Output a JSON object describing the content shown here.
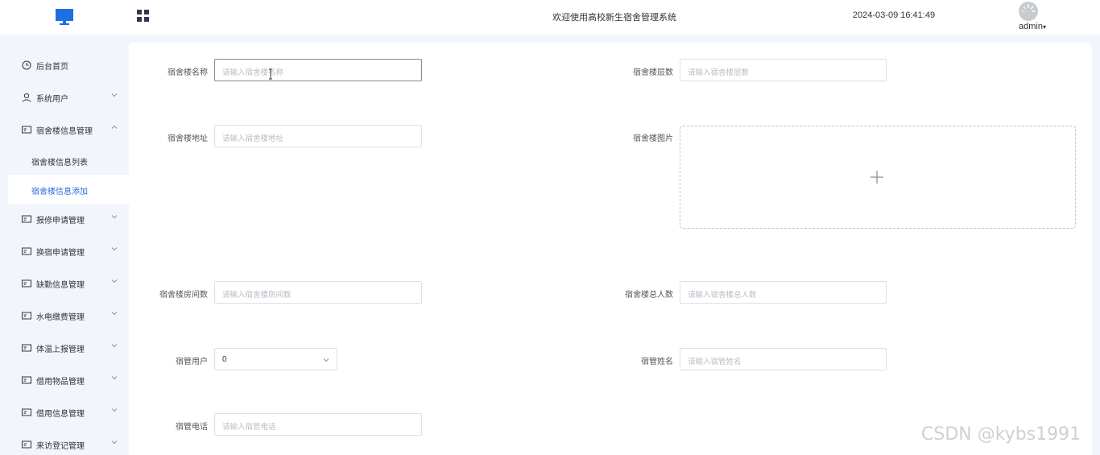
{
  "header": {
    "title": "欢迎使用高校新生宿舍管理系统",
    "datetime": "2024-03-09 16:41:49",
    "user": "admin",
    "user_caret": "▾"
  },
  "sidebar": {
    "items": [
      {
        "label": "后台首页",
        "icon": "clock-icon"
      },
      {
        "label": "系统用户",
        "icon": "user-icon"
      },
      {
        "label": "宿舍楼信息管理",
        "icon": "id-card-icon",
        "expanded": true,
        "children": [
          {
            "label": "宿舍楼信息列表"
          },
          {
            "label": "宿舍楼信息添加",
            "active": true
          }
        ]
      },
      {
        "label": "报修申请管理",
        "icon": "id-card-icon"
      },
      {
        "label": "换宿申请管理",
        "icon": "id-card-icon"
      },
      {
        "label": "缺勤信息管理",
        "icon": "id-card-icon"
      },
      {
        "label": "水电缴费管理",
        "icon": "id-card-icon"
      },
      {
        "label": "体温上报管理",
        "icon": "id-card-icon"
      },
      {
        "label": "借用物品管理",
        "icon": "id-card-icon"
      },
      {
        "label": "借用信息管理",
        "icon": "id-card-icon"
      },
      {
        "label": "来访登记管理",
        "icon": "id-card-icon"
      }
    ]
  },
  "form": {
    "name": {
      "label": "宿舍楼名称",
      "placeholder": "请输入宿舍楼名称"
    },
    "floors": {
      "label": "宿舍楼层数",
      "placeholder": "请输入宿舍楼层数"
    },
    "address": {
      "label": "宿舍楼地址",
      "placeholder": "请输入宿舍楼地址"
    },
    "image": {
      "label": "宿舍楼图片"
    },
    "rooms": {
      "label": "宿舍楼房间数",
      "placeholder": "请输入宿舍楼房间数"
    },
    "capacity": {
      "label": "宿舍楼总人数",
      "placeholder": "请输入宿舍楼总人数"
    },
    "manager_user": {
      "label": "宿管用户",
      "value": "0"
    },
    "manager_name": {
      "label": "宿管姓名",
      "placeholder": "请输入宿管姓名"
    },
    "manager_phone": {
      "label": "宿管电话",
      "placeholder": "请输入宿管电话"
    }
  },
  "watermark": "CSDN @kybs1991",
  "colors": {
    "accent": "#2b6cd6",
    "logo": "#1e6fe0",
    "sidebar_bg": "#f2f6fc"
  }
}
